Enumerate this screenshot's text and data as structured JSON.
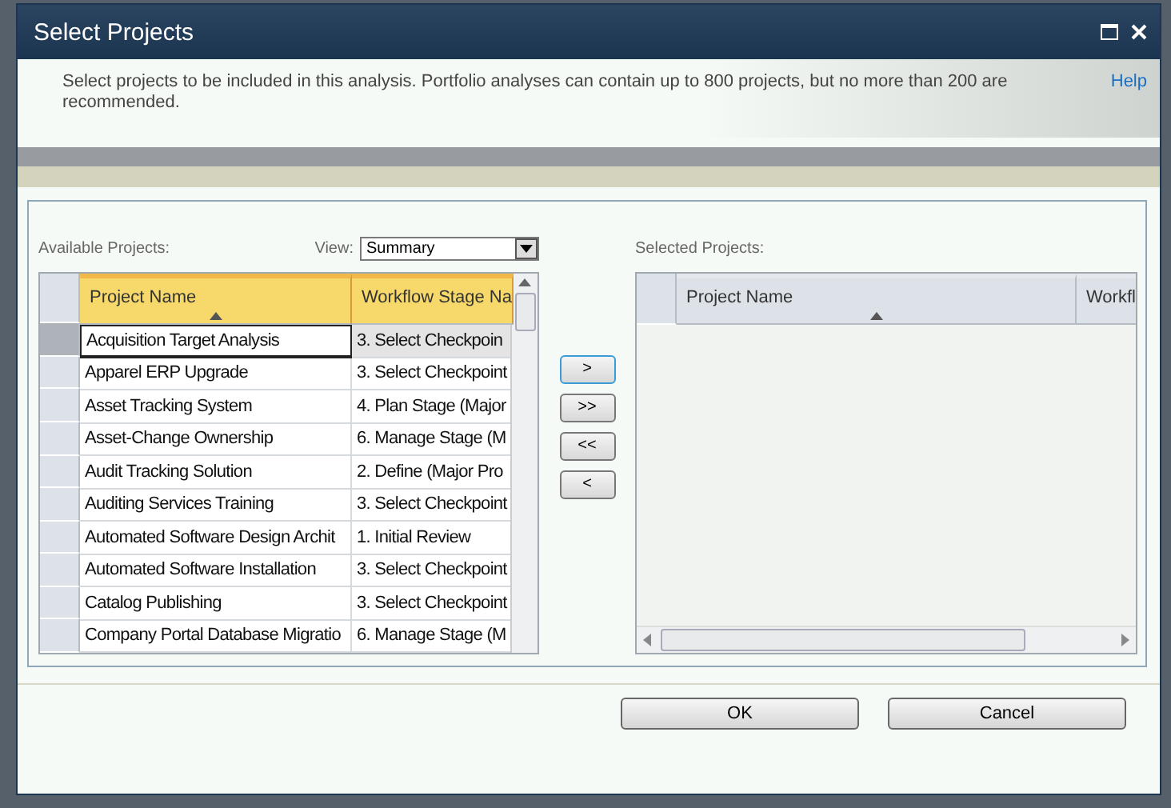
{
  "window": {
    "title": "Select Projects"
  },
  "description": "Select projects to be included in this analysis. Portfolio analyses can contain up to 800 projects, but no more than 200 are recommended.",
  "help_link": "Help",
  "available": {
    "label": "Available Projects:",
    "view_label": "View:",
    "view_value": "Summary",
    "columns": [
      {
        "label": "Project Name",
        "sorted": true
      },
      {
        "label": "Workflow Stage Na",
        "sorted": false
      }
    ],
    "rows": [
      {
        "name": "Acquisition Target Analysis",
        "stage": "3. Select Checkpoin",
        "selected": true
      },
      {
        "name": "Apparel ERP Upgrade",
        "stage": "3. Select Checkpoint",
        "selected": false
      },
      {
        "name": "Asset Tracking System",
        "stage": "4. Plan Stage (Major",
        "selected": false
      },
      {
        "name": "Asset-Change Ownership",
        "stage": "6. Manage Stage (M",
        "selected": false
      },
      {
        "name": "Audit Tracking Solution",
        "stage": "2. Define (Major Pro",
        "selected": false
      },
      {
        "name": "Auditing Services Training",
        "stage": "3. Select Checkpoint",
        "selected": false
      },
      {
        "name": "Automated Software Design Archit",
        "stage": "1. Initial Review",
        "selected": false
      },
      {
        "name": "Automated Software Installation",
        "stage": "3. Select Checkpoint",
        "selected": false
      },
      {
        "name": "Catalog Publishing",
        "stage": "3. Select Checkpoint",
        "selected": false
      },
      {
        "name": "Company Portal Database Migratio",
        "stage": "6. Manage Stage (M",
        "selected": false
      }
    ]
  },
  "move_buttons": [
    {
      "label": ">",
      "focused": true
    },
    {
      "label": ">>",
      "focused": false
    },
    {
      "label": "<<",
      "focused": false
    },
    {
      "label": "<",
      "focused": false
    }
  ],
  "selected_projects": {
    "label": "Selected Projects:",
    "columns": [
      {
        "label": "Project Name",
        "sorted": true
      },
      {
        "label": "Workfl",
        "sorted": false
      }
    ]
  },
  "buttons": [
    "OK",
    "Cancel"
  ]
}
